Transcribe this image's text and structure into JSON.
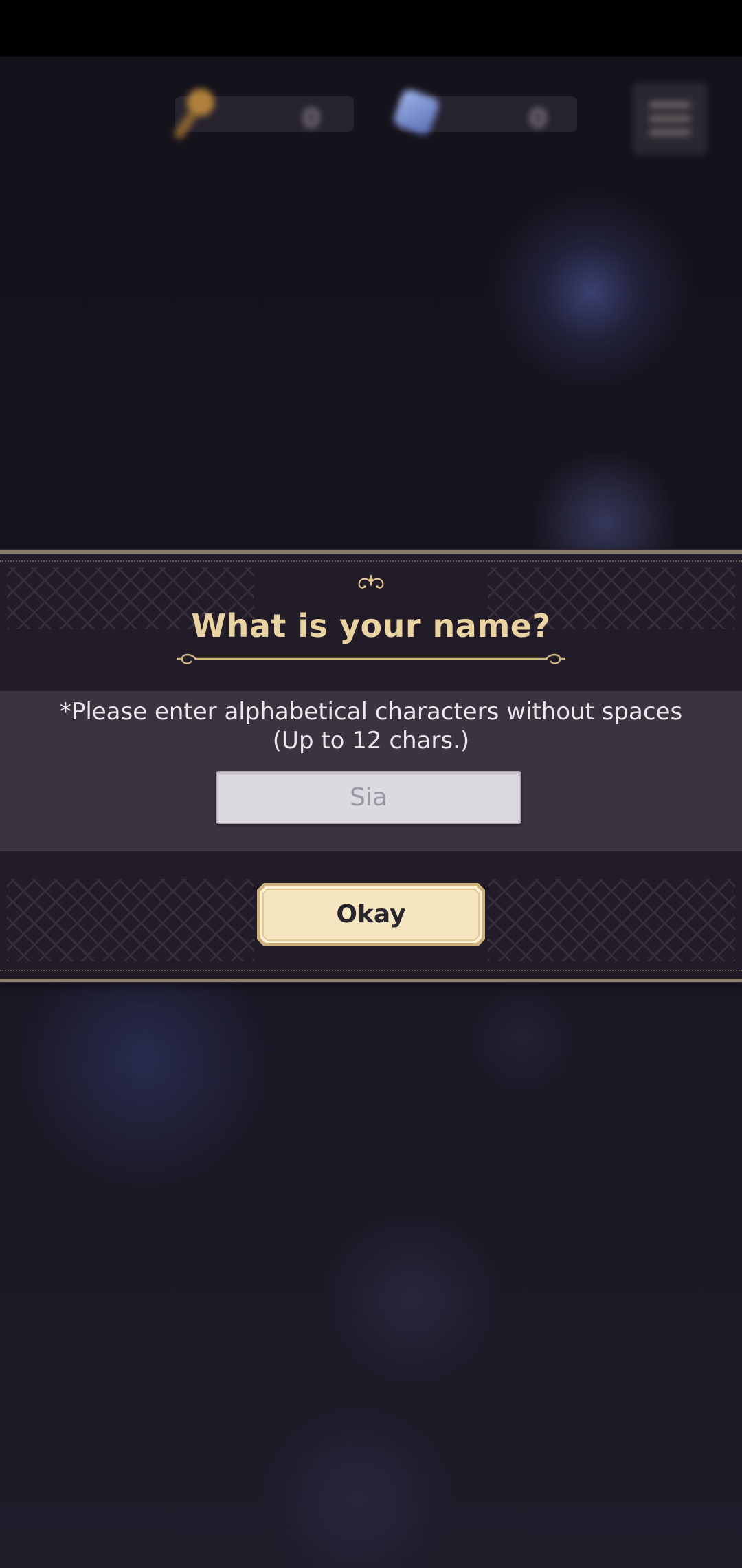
{
  "hud": {
    "key_amount": "0",
    "gem_amount": "0"
  },
  "dialog": {
    "title": "What is your name?",
    "instruction_line1": "*Please enter alphabetical characters without spaces",
    "instruction_line2": "(Up to 12 chars.)",
    "name_input": {
      "placeholder": "Sia",
      "value": ""
    },
    "okay_label": "Okay"
  },
  "colors": {
    "title_gold": "#e9d3a1",
    "button_fill": "#f6e6bf",
    "dialog_bg": "#221b28"
  }
}
